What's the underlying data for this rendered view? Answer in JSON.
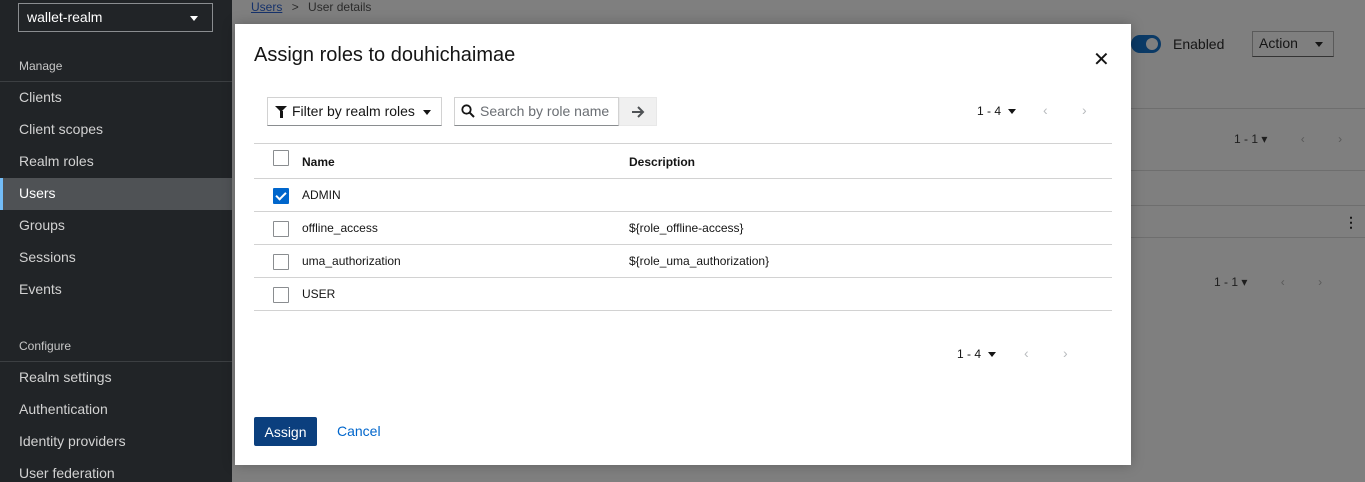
{
  "sidebar": {
    "realm": "wallet-realm",
    "sections": [
      {
        "title": "Manage",
        "items": [
          "Clients",
          "Client scopes",
          "Realm roles",
          "Users",
          "Groups",
          "Sessions",
          "Events"
        ]
      },
      {
        "title": "Configure",
        "items": [
          "Realm settings",
          "Authentication",
          "Identity providers",
          "User federation"
        ]
      }
    ],
    "active": "Users"
  },
  "background": {
    "breadcrumb": {
      "parent": "Users",
      "separator": ">",
      "current": "User details"
    },
    "enabled_label": "Enabled",
    "action_label": "Action",
    "pagination_1": "1 - 1",
    "pagination_2": "1 - 1"
  },
  "modal": {
    "title": "Assign roles to douhichaimae",
    "filter_label": "Filter by realm roles",
    "search_placeholder": "Search by role name",
    "pagination_top": "1 - 4",
    "pagination_bottom": "1 - 4",
    "table": {
      "headers": {
        "name": "Name",
        "description": "Description"
      },
      "rows": [
        {
          "name": "ADMIN",
          "description": "",
          "checked": true
        },
        {
          "name": "offline_access",
          "description": "${role_offline-access}",
          "checked": false
        },
        {
          "name": "uma_authorization",
          "description": "${role_uma_authorization}",
          "checked": false
        },
        {
          "name": "USER",
          "description": "",
          "checked": false
        }
      ]
    },
    "assign_label": "Assign",
    "cancel_label": "Cancel"
  },
  "colors": {
    "primary": "#0b3f7e",
    "link": "#06c",
    "sidebar": "#212427"
  }
}
